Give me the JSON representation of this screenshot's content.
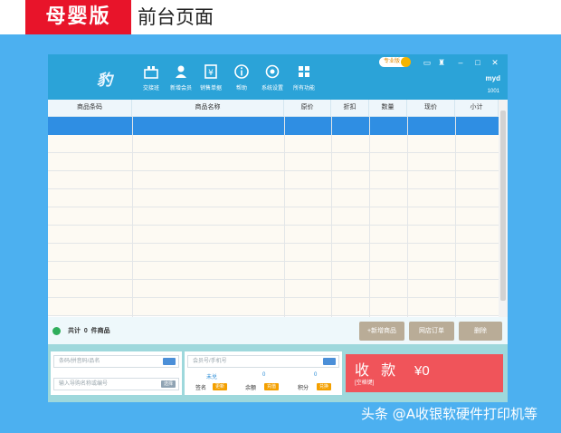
{
  "banner": {
    "badge": "母婴版",
    "title": "前台页面"
  },
  "app": {
    "logo": "豹",
    "toolbar": [
      {
        "label": "交接班",
        "icon": "handover-icon"
      },
      {
        "label": "新增会员",
        "icon": "add-member-icon"
      },
      {
        "label": "销售单据",
        "icon": "sales-receipt-icon"
      },
      {
        "label": "帮助",
        "icon": "help-icon"
      },
      {
        "label": "系统设置",
        "icon": "settings-icon"
      },
      {
        "label": "所有功能",
        "icon": "all-functions-icon"
      }
    ],
    "edition": "专业版",
    "user": "myd",
    "user_id": "1001"
  },
  "table": {
    "columns": [
      "商品条码",
      "商品名称",
      "原价",
      "折扣",
      "数量",
      "现价",
      "小计"
    ],
    "selected_row": 0,
    "row_count": 11
  },
  "summary": {
    "text": "共计  0  件商品"
  },
  "actions": {
    "add_product": "+新增商品",
    "store_order": "网店订单",
    "delete": "删除"
  },
  "inputs": {
    "barcode_placeholder": "条码/拼音码/品名",
    "guide_placeholder": "输入导购名称或编号",
    "guide_select": "选择",
    "member_placeholder": "会员号/手机号"
  },
  "member_stats": {
    "points_redeem": {
      "value": "未兑",
      "label": "兑换"
    },
    "signin": {
      "label": "签名",
      "chip": "更新"
    },
    "balance": {
      "value": "0",
      "label": "余额",
      "chip": "充值"
    },
    "points": {
      "value": "0",
      "label": "积分",
      "chip": "兑换"
    }
  },
  "pay": {
    "title": "收 款",
    "hint": "[空格键]",
    "amount": "¥0"
  },
  "watermark": "头条 @A收银软硬件打印机等",
  "colors": {
    "header": "#2ba3d8",
    "selected_row": "#2f8ee3",
    "pay": "#f0545a",
    "badge": "#e8142a"
  }
}
